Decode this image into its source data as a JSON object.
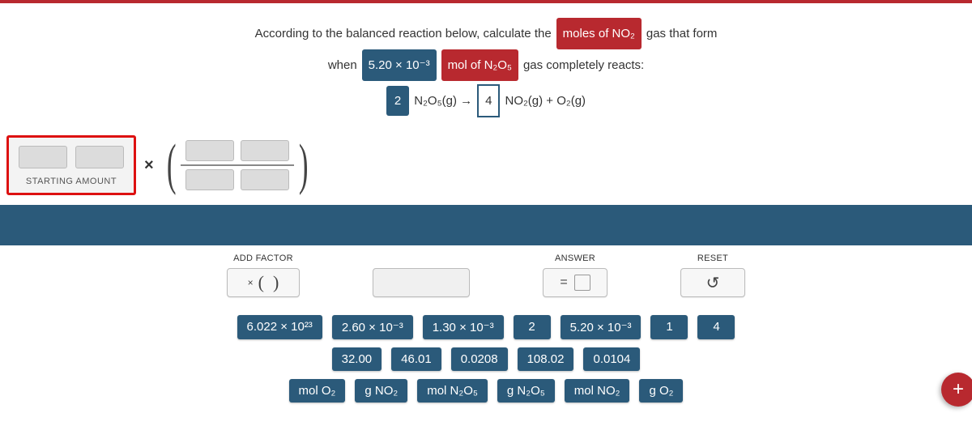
{
  "question": {
    "line1_pre": "According to the balanced reaction below, calculate the",
    "line1_chip": "moles of NO₂",
    "line1_post": "gas that form",
    "line2_pre": "when",
    "line2_chip1": "5.20 × 10⁻³",
    "line2_chip2": "mol of N₂O₅",
    "line2_post": "gas completely reacts:",
    "coef1": "2",
    "reactant": "N₂O₅(g) →",
    "coef2": "4",
    "product": "NO₂(g) + O₂(g)"
  },
  "starting_label": "STARTING AMOUNT",
  "times": "×",
  "controls": {
    "add_factor": "ADD FACTOR",
    "answer": "ANSWER",
    "reset": "RESET",
    "equals": "=",
    "reset_icon": "↺"
  },
  "tiles": {
    "row1": [
      "6.022 × 10²³",
      "2.60 × 10⁻³",
      "1.30 × 10⁻³",
      "2",
      "5.20 × 10⁻³",
      "1",
      "4"
    ],
    "row2": [
      "32.00",
      "46.01",
      "0.0208",
      "108.02",
      "0.0104"
    ],
    "row3": [
      "mol O₂",
      "g NO₂",
      "mol N₂O₅",
      "g N₂O₅",
      "mol NO₂",
      "g O₂"
    ]
  },
  "fab": "+"
}
